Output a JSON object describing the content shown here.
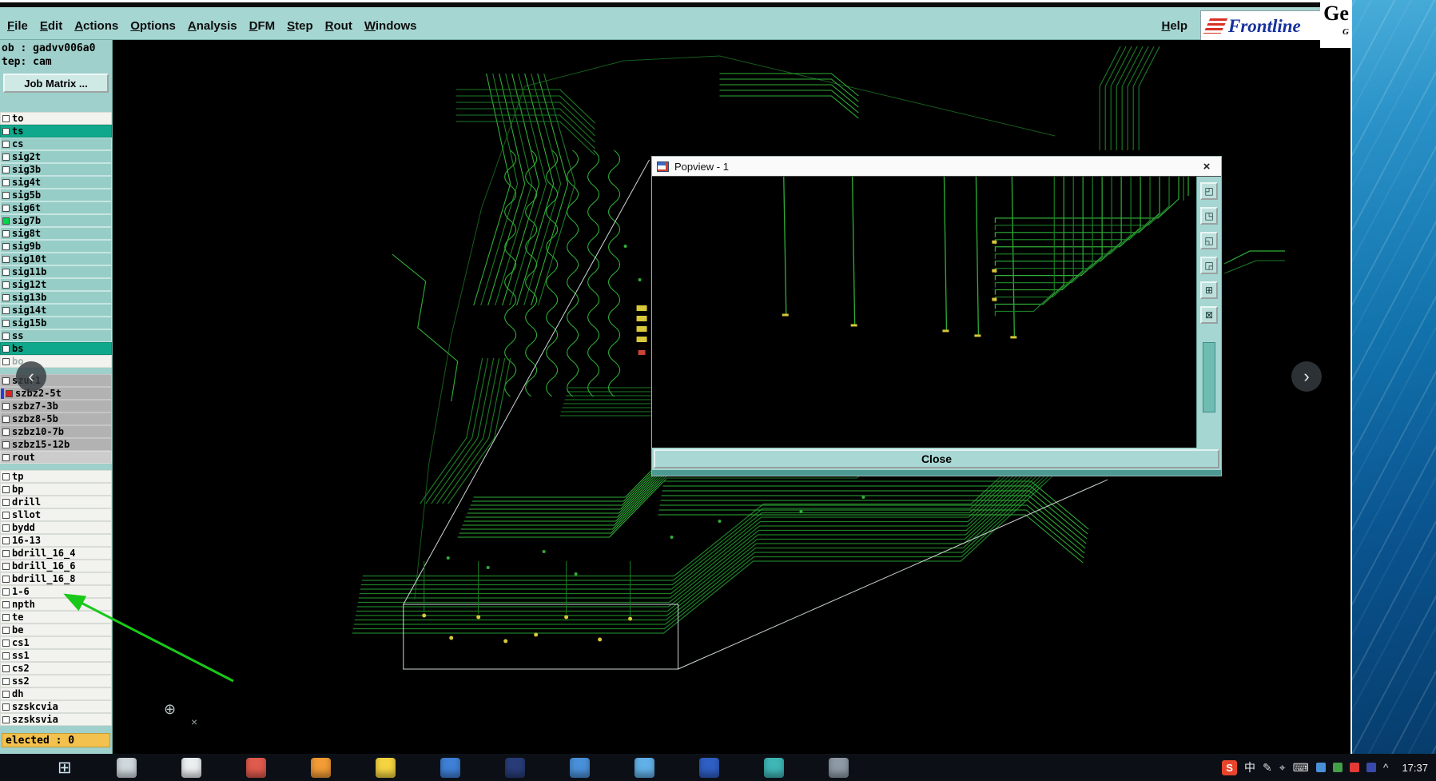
{
  "menubar": {
    "items": [
      "File",
      "Edit",
      "Actions",
      "Options",
      "Analysis",
      "DFM",
      "Step",
      "Rout",
      "Windows"
    ],
    "help": "Help",
    "brand": "Frontline",
    "window_title_fragment": "Ge",
    "window_subtitle_fragment": "G"
  },
  "sidebar": {
    "job": "ob : gadvv006a0",
    "step": "tep: cam",
    "matrix_button": "Job Matrix ...",
    "selected": "elected : 0",
    "layer_groups": [
      {
        "rows": [
          {
            "label": "to",
            "bg": "white"
          },
          {
            "label": "ts",
            "bg": "sel"
          },
          {
            "label": "cs",
            "bg": "teal"
          },
          {
            "label": "sig2t",
            "bg": "teal"
          },
          {
            "label": "sig3b",
            "bg": "teal"
          },
          {
            "label": "sig4t",
            "bg": "teal"
          },
          {
            "label": "sig5b",
            "bg": "teal"
          },
          {
            "label": "sig6t",
            "bg": "teal"
          },
          {
            "label": "sig7b",
            "bg": "teal",
            "swatch": "#00d94a"
          },
          {
            "label": "sig8t",
            "bg": "teal"
          },
          {
            "label": "sig9b",
            "bg": "teal"
          },
          {
            "label": "sig10t",
            "bg": "teal"
          },
          {
            "label": "sig11b",
            "bg": "teal"
          },
          {
            "label": "sig12t",
            "bg": "teal"
          },
          {
            "label": "sig13b",
            "bg": "teal"
          },
          {
            "label": "sig14t",
            "bg": "teal"
          },
          {
            "label": "sig15b",
            "bg": "teal"
          },
          {
            "label": "ss",
            "bg": "teal"
          },
          {
            "label": "bs",
            "bg": "sel"
          },
          {
            "label": "bo",
            "bg": "dim"
          }
        ]
      },
      {
        "rows": [
          {
            "label": "szur1",
            "bg": "gray"
          },
          {
            "label": "szbz2-5t",
            "bg": "gray",
            "swatch": "#e02020",
            "edge": "#2a3ce0"
          },
          {
            "label": "szbz7-3b",
            "bg": "gray"
          },
          {
            "label": "szbz8-5b",
            "bg": "gray"
          },
          {
            "label": "szbz10-7b",
            "bg": "gray"
          },
          {
            "label": "szbz15-12b",
            "bg": "gray"
          },
          {
            "label": "rout",
            "bg": "lightgray"
          }
        ]
      },
      {
        "rows": [
          {
            "label": "tp",
            "bg": "white"
          },
          {
            "label": "bp",
            "bg": "white"
          },
          {
            "label": "drill",
            "bg": "white"
          },
          {
            "label": "sllot",
            "bg": "white"
          },
          {
            "label": "bydd",
            "bg": "white"
          },
          {
            "label": "16-13",
            "bg": "white"
          },
          {
            "label": "bdrill_16_4",
            "bg": "white"
          },
          {
            "label": "bdrill_16_6",
            "bg": "white"
          },
          {
            "label": "bdrill_16_8",
            "bg": "white"
          },
          {
            "label": "1-6",
            "bg": "white"
          },
          {
            "label": "npth",
            "bg": "white"
          },
          {
            "label": "te",
            "bg": "white"
          },
          {
            "label": "be",
            "bg": "white"
          },
          {
            "label": "cs1",
            "bg": "white"
          },
          {
            "label": "ss1",
            "bg": "white"
          },
          {
            "label": "cs2",
            "bg": "white"
          },
          {
            "label": "ss2",
            "bg": "white"
          },
          {
            "label": "dh",
            "bg": "white"
          },
          {
            "label": "szskcvia",
            "bg": "white"
          },
          {
            "label": "szsksvia",
            "bg": "white"
          }
        ]
      }
    ]
  },
  "popview": {
    "title": "Popview - 1",
    "close_x": "×",
    "close_button": "Close",
    "tools": [
      "◰",
      "◳",
      "◱",
      "◲",
      "⊞",
      "⊠"
    ]
  },
  "nav": {
    "prev": "‹",
    "next": "›"
  },
  "taskbar": {
    "time": "17:37",
    "start_glyph": "⊞",
    "apps": [
      {
        "name": "taskbar-app-icon",
        "color": "#cfd8dc"
      },
      {
        "name": "taskbar-app-icon",
        "color": "#eceff1"
      },
      {
        "name": "taskbar-app-icon",
        "color": "#e05a4e"
      },
      {
        "name": "taskbar-app-icon",
        "color": "#f39c35"
      },
      {
        "name": "taskbar-app-icon",
        "color": "#f5d442"
      },
      {
        "name": "taskbar-app-icon",
        "color": "#3f7fd6"
      },
      {
        "name": "taskbar-app-icon",
        "color": "#283c78"
      },
      {
        "name": "taskbar-app-icon",
        "color": "#4a90d9"
      },
      {
        "name": "taskbar-app-icon",
        "color": "#62b0e8"
      },
      {
        "name": "taskbar-app-icon",
        "color": "#2f5fc4"
      },
      {
        "name": "taskbar-app-icon",
        "color": "#3fb6b6"
      },
      {
        "name": "taskbar-app-icon",
        "color": "#8e9aa6"
      }
    ],
    "tray": [
      {
        "name": "sogou-input-icon",
        "glyph": "S",
        "bg": "#e8442c",
        "fg": "#ffffff"
      },
      {
        "name": "chinese-lang-icon",
        "glyph": "中",
        "fg": "#f0f0f0"
      },
      {
        "name": "pen-icon",
        "glyph": "✎",
        "fg": "#d8d8d8"
      },
      {
        "name": "mic-icon",
        "glyph": "⌖",
        "fg": "#d8d8d8"
      },
      {
        "name": "keyboard-icon",
        "glyph": "⌨",
        "fg": "#d8d8d8"
      },
      {
        "name": "tray-tile-icon",
        "tile": "#4a90d9"
      },
      {
        "name": "tray-tile-icon",
        "tile": "#43a047"
      },
      {
        "name": "tray-tile-icon",
        "tile": "#e53935"
      },
      {
        "name": "tray-tile-icon",
        "tile": "#3949ab"
      },
      {
        "name": "hidden-icons-chevron",
        "glyph": "^",
        "fg": "#d8d8d8"
      }
    ]
  },
  "colors": {
    "ui_teal": "#a5d6d2",
    "trace_green": "#2fae37",
    "layer_highlight": "#10a88c",
    "selected_bar": "#f2c14e",
    "taskbar_bg": "#0c1016"
  }
}
